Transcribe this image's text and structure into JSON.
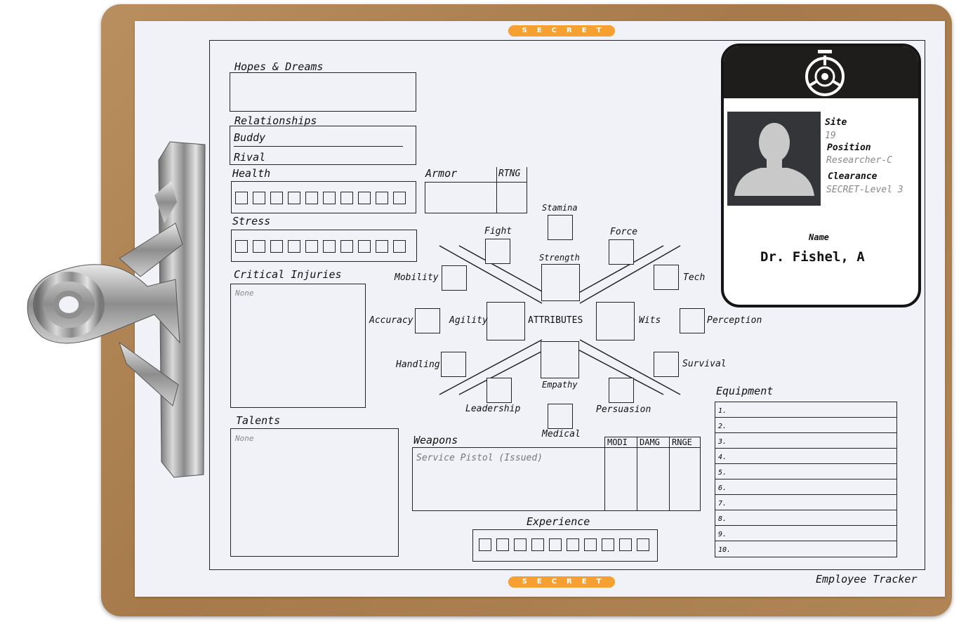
{
  "header_badge": "SECRET",
  "footer_badge": "SECRET",
  "footer_title": "Employee Tracker",
  "hopes": {
    "label": "Hopes & Dreams"
  },
  "relationships": {
    "label": "Relationships",
    "buddy": "Buddy",
    "rival": "Rival"
  },
  "health": {
    "label": "Health",
    "boxes": 10
  },
  "stress": {
    "label": "Stress",
    "boxes": 10
  },
  "armor": {
    "label": "Armor",
    "rating_label": "RTNG"
  },
  "critical_injuries": {
    "label": "Critical Injuries",
    "value": "None"
  },
  "talents": {
    "label": "Talents",
    "value": "None"
  },
  "attributes": {
    "center": "ATTRIBUTES",
    "stamina": "Stamina",
    "strength": "Strength",
    "fight": "Fight",
    "force": "Force",
    "mobility": "Mobility",
    "tech": "Tech",
    "accuracy": "Accuracy",
    "agility": "Agility",
    "wits": "Wits",
    "perception": "Perception",
    "handling": "Handling",
    "survival": "Survival",
    "empathy": "Empathy",
    "leadership": "Leadership",
    "persuasion": "Persuasion",
    "medical": "Medical"
  },
  "weapons": {
    "label": "Weapons",
    "col_mod": "MODI",
    "col_dmg": "DAMG",
    "col_range": "RNGE",
    "entry": "Service Pistol (Issued)"
  },
  "experience": {
    "label": "Experience",
    "boxes": 10
  },
  "equipment": {
    "label": "Equipment",
    "rows": [
      "1.",
      "2.",
      "3.",
      "4.",
      "5.",
      "6.",
      "7.",
      "8.",
      "9.",
      "10."
    ]
  },
  "id_card": {
    "logo": "scp-foundation-logo-icon",
    "site_label": "Site",
    "site_value": "19",
    "position_label": "Position",
    "position_value": "Researcher-C",
    "clearance_label": "Clearance",
    "clearance_value": "SECRET-Level 3",
    "name_label": "Name",
    "name_value": "Dr. Fishel, A"
  },
  "colors": {
    "badge": "#f5a030",
    "board": "#b08556",
    "paper": "#f1f2f8",
    "ink": "#222222"
  }
}
